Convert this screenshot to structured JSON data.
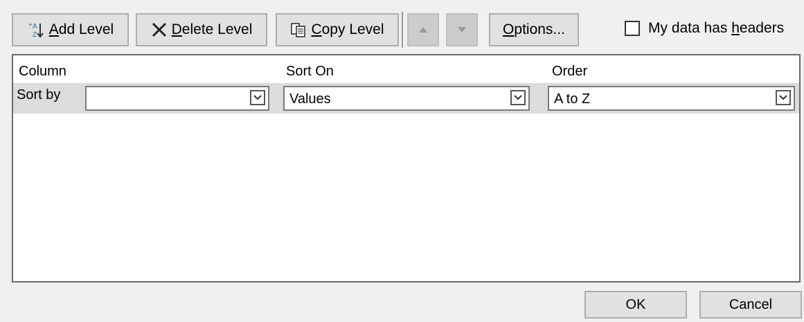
{
  "toolbar": {
    "add_level_prefix": "",
    "add_level_accel": "A",
    "add_level_rest": "dd Level",
    "delete_level_accel": "D",
    "delete_level_rest": "elete Level",
    "copy_level_accel": "C",
    "copy_level_rest": "opy Level",
    "options_accel": "O",
    "options_rest": "ptions...",
    "headers_label_start": "My data has ",
    "headers_label_accel": "h",
    "headers_label_end": "eaders"
  },
  "grid": {
    "column_header": "Column",
    "sort_on_header": "Sort On",
    "order_header": "Order",
    "row": {
      "label": "Sort by",
      "column_value": "",
      "sort_on_value": "Values",
      "order_value": "A to Z"
    }
  },
  "footer": {
    "ok": "OK",
    "cancel": "Cancel"
  },
  "icons": {
    "add": "sort-az-icon",
    "delete": "x-icon",
    "copy": "copy-icon",
    "up": "arrow-up-icon",
    "down": "arrow-down-icon",
    "dropdown": "chevron-down-icon"
  }
}
